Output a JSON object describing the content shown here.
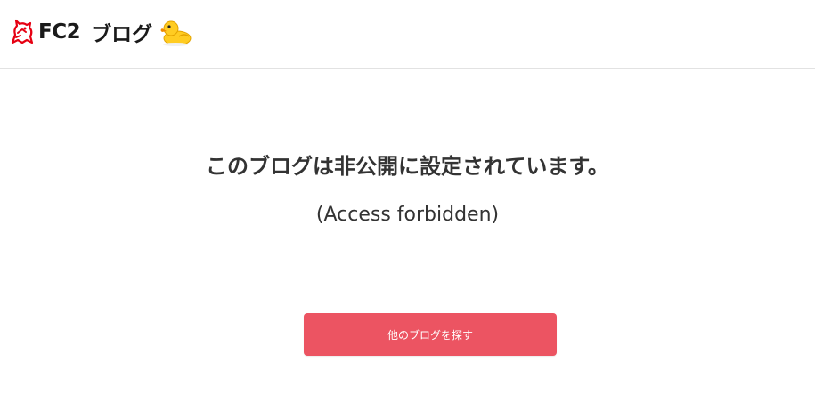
{
  "header": {
    "logo_fc2": "FC2",
    "logo_blog": "ブログ",
    "logo_icon": "fc2-unicorn-icon",
    "mascot_icon": "duck-icon"
  },
  "main": {
    "title": "このブログは非公開に設定されています。",
    "subtitle": "(Access forbidden)",
    "button_label": "他のブログを探す"
  },
  "colors": {
    "button_bg": "#ec5462",
    "logo_red": "#e60012",
    "duck_yellow": "#ffcc22",
    "divider": "#e2e2e2",
    "text": "#333333"
  }
}
